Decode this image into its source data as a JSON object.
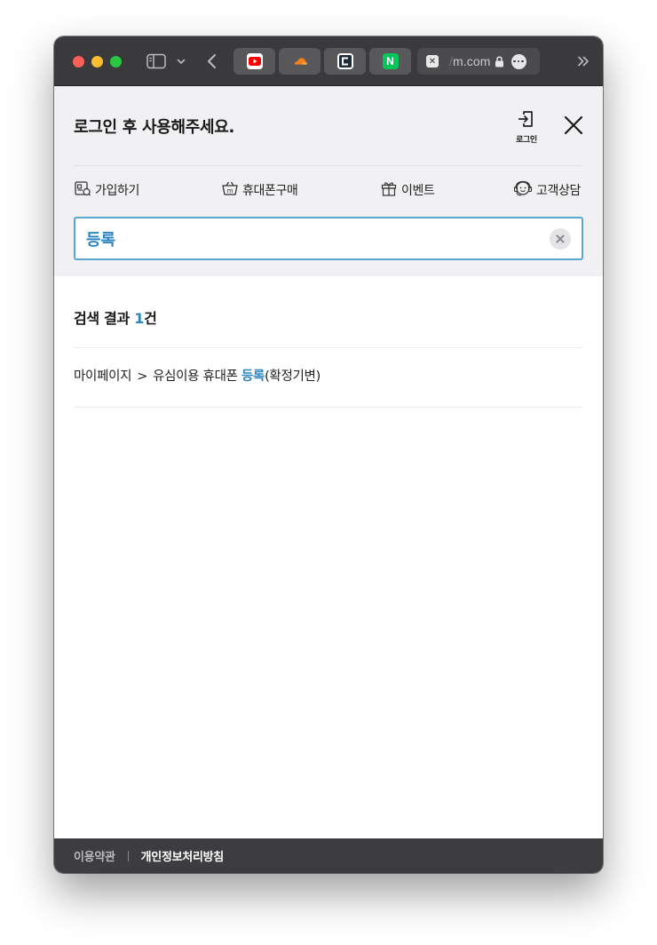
{
  "browser": {
    "tabs": [
      {
        "icon": "youtube-icon"
      },
      {
        "icon": "cloudflare-icon"
      },
      {
        "icon": "c-app-icon"
      },
      {
        "icon": "naver-icon",
        "letter": "N"
      }
    ],
    "active_tab": {
      "favicon": "close-x-favicon",
      "url_faded": "/",
      "url_main": "m.com"
    }
  },
  "header": {
    "login_message": "로그인 후 사용해주세요.",
    "login_button_label": "로그인",
    "quick_menu": [
      {
        "label": "가입하기",
        "icon": "signup-card-icon"
      },
      {
        "label": "휴대폰구매",
        "icon": "basket-icon"
      },
      {
        "label": "이벤트",
        "icon": "gift-icon"
      },
      {
        "label": "고객상담",
        "icon": "headset-icon"
      }
    ],
    "search": {
      "value": "등록",
      "placeholder": ""
    }
  },
  "results": {
    "count_prefix": "검색 결과 ",
    "count_number": "1",
    "count_suffix": "건",
    "items": [
      {
        "path_start": "마이페이지",
        "separator": ">",
        "path_before": "유심이용 휴대폰 ",
        "highlight": "등록",
        "path_after": "(확정기변)"
      }
    ]
  },
  "footer": {
    "terms": "이용약관",
    "privacy": "개인정보처리방침"
  },
  "colors": {
    "accent": "#2e86c1",
    "search_border": "#5aa6d1",
    "header_bg": "#f1f1f3",
    "footer_bg": "#3d3d3f",
    "toolbar_bg": "#3a3a3c"
  }
}
